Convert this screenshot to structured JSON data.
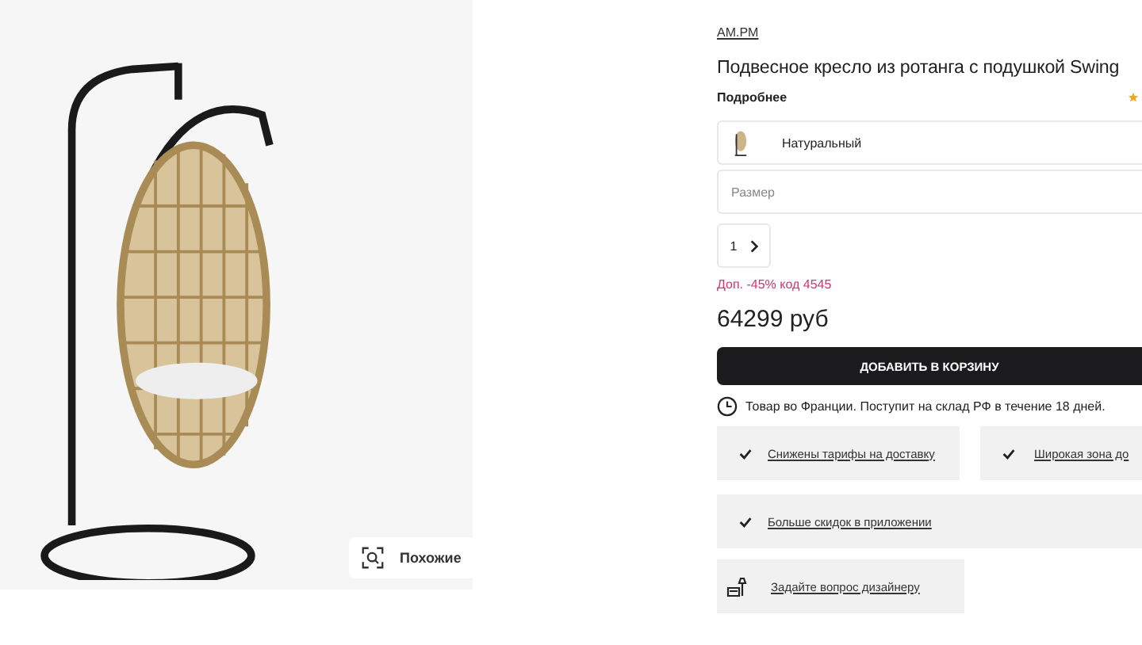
{
  "similar_button": {
    "label": "Похожие"
  },
  "product": {
    "brand": "AM.PM",
    "title": "Подвесное кресло из ротанга с подушкой Swing",
    "details_link": "Подробнее",
    "color_option": "Натуральный",
    "size_placeholder": "Размер",
    "quantity": "1",
    "promo": "Доп. -45% код 4545",
    "price": "64299 руб",
    "add_to_cart": "ДОБАВИТЬ В КОРЗИНУ",
    "delivery_note": "Товар во Франции. Поступит на склад РФ в течение 18 дней."
  },
  "benefits": [
    {
      "kind": "check",
      "text": "Снижены тарифы на доставку"
    },
    {
      "kind": "check",
      "text": "Широкая зона до"
    },
    {
      "kind": "check",
      "text": "Больше скидок в приложении"
    },
    {
      "kind": "designer",
      "text": "Задайте вопрос дизайнеру"
    }
  ]
}
